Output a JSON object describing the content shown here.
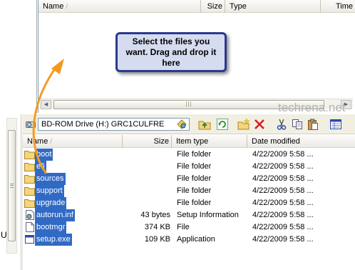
{
  "top_pane": {
    "columns": [
      {
        "label": "Name"
      },
      {
        "label": "Size"
      },
      {
        "label": "Type"
      },
      {
        "label": "Time"
      }
    ]
  },
  "callout": {
    "text": "Select the files you want. Drag and drop it here"
  },
  "watermark": "techrena.net",
  "toolbar": {
    "drive_label": "BD-ROM Drive (H:) GRC1CULFRE",
    "buttons": [
      "up-folder-icon",
      "refresh-icon",
      "new-folder-icon",
      "delete-icon",
      "cut-icon",
      "copy-icon",
      "paste-icon",
      "details-view-icon"
    ]
  },
  "left_strip_char": "U",
  "file_list": {
    "columns": [
      {
        "label": "Name"
      },
      {
        "label": "Size"
      },
      {
        "label": "Item type"
      },
      {
        "label": "Date modified"
      }
    ],
    "rows": [
      {
        "name": "boot",
        "size": "",
        "type": "File folder",
        "date": "4/22/2009 5:58 ...",
        "icon": "folder-icon"
      },
      {
        "name": "efi",
        "size": "",
        "type": "File folder",
        "date": "4/22/2009 5:58 ...",
        "icon": "folder-icon"
      },
      {
        "name": "sources",
        "size": "",
        "type": "File folder",
        "date": "4/22/2009 5:58 ...",
        "icon": "folder-icon"
      },
      {
        "name": "support",
        "size": "",
        "type": "File folder",
        "date": "4/22/2009 5:58 ...",
        "icon": "folder-icon"
      },
      {
        "name": "upgrade",
        "size": "",
        "type": "File folder",
        "date": "4/22/2009 5:58 ...",
        "icon": "folder-icon"
      },
      {
        "name": "autorun.inf",
        "size": "43 bytes",
        "type": "Setup Information",
        "date": "4/22/2009 5:58 ...",
        "icon": "settings-file-icon"
      },
      {
        "name": "bootmgr",
        "size": "374 KB",
        "type": "File",
        "date": "4/22/2009 5:58 ...",
        "icon": "file-icon"
      },
      {
        "name": "setup.exe",
        "size": "109 KB",
        "type": "Application",
        "date": "4/22/2009 5:58 ...",
        "icon": "application-icon"
      }
    ]
  },
  "colors": {
    "selection": "#316ac5",
    "callout_fill": "#d6dcf0",
    "callout_border": "#2b3a8f",
    "arrow": "#f39a1e"
  }
}
